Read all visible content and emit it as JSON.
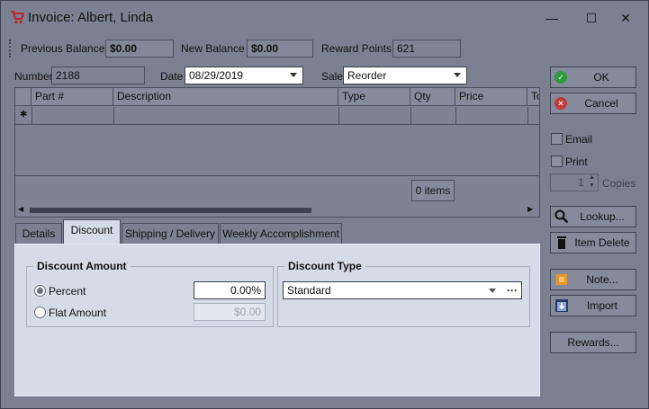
{
  "window": {
    "title": "Invoice: Albert, Linda",
    "minimize_glyph": "—",
    "maximize_glyph": "☐",
    "close_glyph": "✕"
  },
  "summary": {
    "previous_balance_label": "Previous Balance",
    "previous_balance_value": "$0.00",
    "new_balance_label": "New Balance",
    "new_balance_value": "$0.00",
    "reward_points_label": "Reward Points",
    "reward_points_value": "621"
  },
  "header_fields": {
    "number_label": "Number",
    "number_value": "2188",
    "date_label": "Date",
    "date_value": "08/29/2019",
    "sale_label": "Sale",
    "sale_value": "Reorder"
  },
  "grid": {
    "columns": [
      "Part #",
      "Description",
      "Type",
      "Qty",
      "Price",
      "To"
    ],
    "new_row_marker": "✱",
    "item_count": "0 items"
  },
  "tabs": [
    {
      "label": "Details"
    },
    {
      "label": "Discount"
    },
    {
      "label": "Shipping / Delivery"
    },
    {
      "label": "Weekly Accomplishment"
    }
  ],
  "discount": {
    "amount_group_title": "Discount Amount",
    "percent_label": "Percent",
    "percent_value": "0.00%",
    "flat_label": "Flat Amount",
    "flat_value": "$0.00",
    "type_group_title": "Discount Type",
    "type_value": "Standard",
    "ellipsis": "···"
  },
  "actions": {
    "ok": "OK",
    "cancel": "Cancel",
    "email": "Email",
    "print": "Print",
    "copies_value": "1",
    "copies_label": "Copies",
    "lookup": "Lookup...",
    "item_delete": "Item Delete",
    "note": "Note...",
    "import": "Import",
    "rewards": "Rewards..."
  },
  "colors": {
    "ok_green": "#2e9b3a",
    "cancel_red": "#c23b3b",
    "cart_red": "#c0202a",
    "note_orange": "#e8962a"
  }
}
